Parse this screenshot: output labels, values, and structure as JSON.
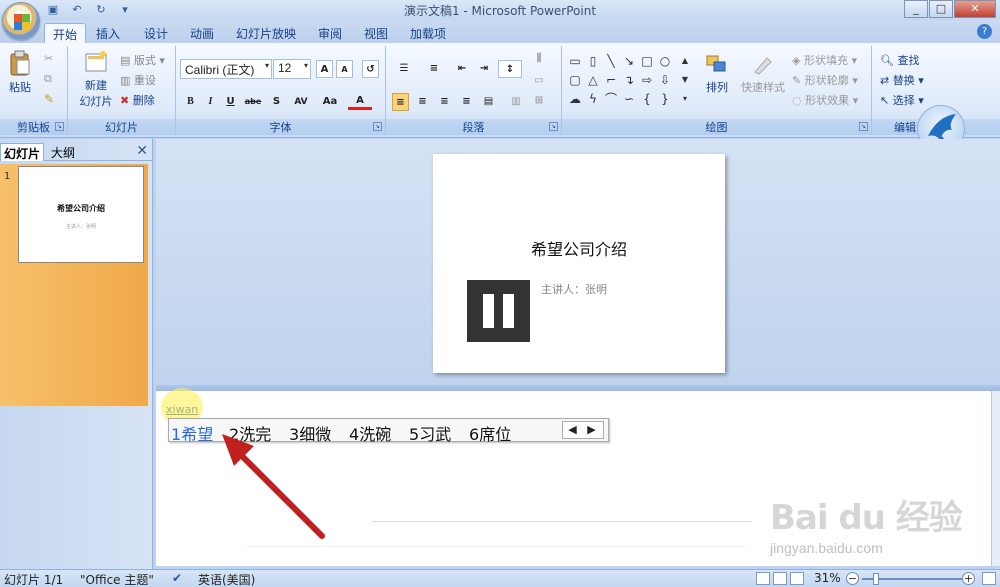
{
  "window": {
    "title": "演示文稿1 - Microsoft PowerPoint"
  },
  "tabs": [
    "开始",
    "插入",
    "设计",
    "动画",
    "幻灯片放映",
    "审阅",
    "视图",
    "加载项"
  ],
  "ribbon": {
    "clipboard": {
      "label": "剪贴板",
      "paste": "粘贴"
    },
    "slides": {
      "label": "幻灯片",
      "new_slide_l1": "新建",
      "new_slide_l2": "幻灯片",
      "layout": "版式",
      "reset": "重设",
      "delete": "删除"
    },
    "font": {
      "label": "字体",
      "font_name": "Calibri (正文)",
      "font_size": "12",
      "bold": "B",
      "italic": "I",
      "underline": "U",
      "strike": "abe",
      "shadow": "S",
      "spacing": "AV",
      "case": "Aa",
      "color": "A",
      "grow": "A",
      "shrink": "A"
    },
    "paragraph": {
      "label": "段落"
    },
    "drawing": {
      "label": "绘图",
      "arrange": "排列",
      "quick_styles": "快速样式",
      "fill": "形状填充",
      "outline": "形状轮廓",
      "effects": "形状效果"
    },
    "editing": {
      "label": "编辑",
      "find": "查找",
      "replace": "替换",
      "select": "选择"
    }
  },
  "left_pane": {
    "tab_slides": "幻灯片",
    "tab_outline": "大纲",
    "slide_number": "1",
    "thumb_title": "希望公司介绍",
    "thumb_subtitle": "主讲人：张明"
  },
  "slide": {
    "title": "希望公司介绍",
    "subtitle": "主讲人：张明"
  },
  "notes": {
    "typed_text": "xiwan"
  },
  "ime": {
    "candidates": [
      {
        "num": "1",
        "text": "希望"
      },
      {
        "num": "2",
        "text": "洗完"
      },
      {
        "num": "3",
        "text": "细微"
      },
      {
        "num": "4",
        "text": "洗碗"
      },
      {
        "num": "5",
        "text": "习武"
      },
      {
        "num": "6",
        "text": "席位"
      }
    ],
    "prev": "◀",
    "next": "▶"
  },
  "watermark": {
    "logo": "Bai du 经验",
    "url": "jingyan.baidu.com"
  },
  "status": {
    "slide_info": "幻灯片 1/1",
    "theme": "\"Office 主题\"",
    "language": "英语(美国)",
    "zoom": "31%"
  },
  "colors": {
    "accent": "#15428b",
    "arrow": "#c0201e",
    "selected_candidate": "#2a6be0",
    "thumb_highlight": "#f0a949"
  }
}
